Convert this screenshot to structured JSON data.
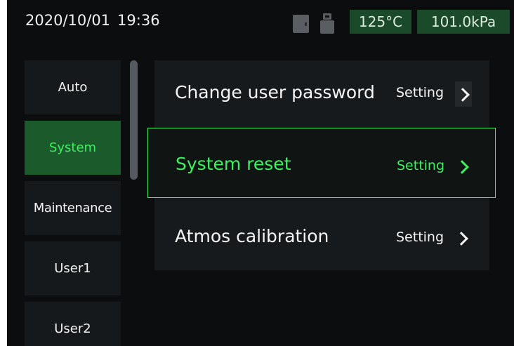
{
  "status": {
    "date": "2020/10/01",
    "time": "19:36",
    "icons": [
      "sd-card-icon",
      "usb-drive-icon"
    ],
    "temperature": "125°C",
    "pressure": "101.0kPa"
  },
  "sidebar": {
    "items": [
      {
        "label": "Auto",
        "active": false
      },
      {
        "label": "System",
        "active": true
      },
      {
        "label": "Maintenance",
        "active": false
      },
      {
        "label": "User1",
        "active": false
      },
      {
        "label": "User2",
        "active": false
      }
    ]
  },
  "menu": {
    "rows": [
      {
        "label": "Change user password",
        "action": "Setting",
        "selected": false
      },
      {
        "label": "System reset",
        "action": "Setting",
        "selected": true
      },
      {
        "label": "Atmos calibration",
        "action": "Setting",
        "selected": false
      }
    ]
  },
  "colors": {
    "background": "#0b0d0e",
    "panel": "#171a1c",
    "accent": "#3ef060",
    "active_bg": "#1b5a2a",
    "badge_bg": "#1b4a2a"
  }
}
